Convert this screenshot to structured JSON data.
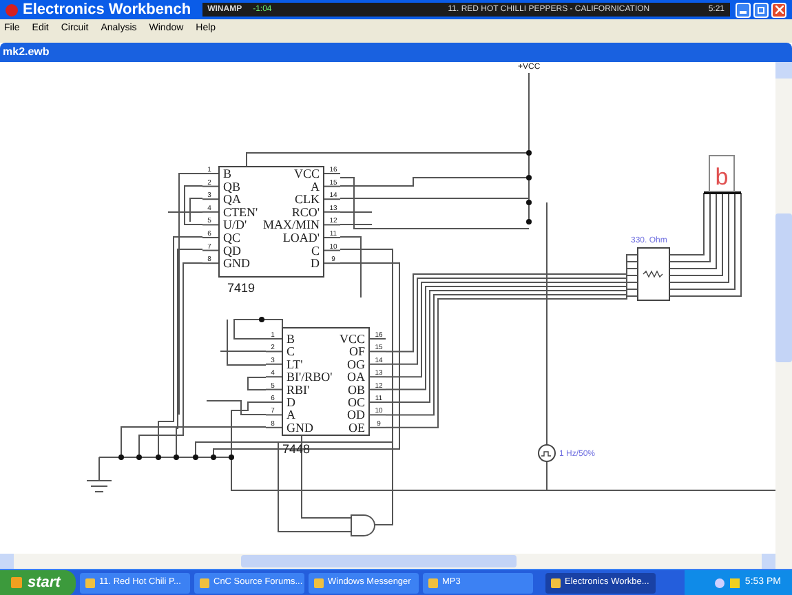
{
  "window": {
    "title": "Electronics Workbench"
  },
  "winamp": {
    "label": "WINAMP",
    "time": "-1:04",
    "track": "11. RED HOT CHILLI PEPPERS - CALIFORNICATION",
    "length": "5:21"
  },
  "menu": [
    "File",
    "Edit",
    "Circuit",
    "Analysis",
    "Window",
    "Help"
  ],
  "document": {
    "title": "mk2.ewb"
  },
  "circuit": {
    "supply": "+VCC",
    "chips": [
      {
        "part": "7419",
        "left_pins": [
          {
            "number": "1",
            "label": "B"
          },
          {
            "number": "2",
            "label": "QB"
          },
          {
            "number": "3",
            "label": "QA"
          },
          {
            "number": "4",
            "label": "CTEN'"
          },
          {
            "number": "5",
            "label": "U/D'"
          },
          {
            "number": "6",
            "label": "QC"
          },
          {
            "number": "7",
            "label": "QD"
          },
          {
            "number": "8",
            "label": "GND"
          }
        ],
        "right_pins": [
          {
            "number": "16",
            "label": "VCC"
          },
          {
            "number": "15",
            "label": "A"
          },
          {
            "number": "14",
            "label": "CLK"
          },
          {
            "number": "13",
            "label": "RCO'"
          },
          {
            "number": "12",
            "label": "MAX/MIN"
          },
          {
            "number": "11",
            "label": "LOAD'"
          },
          {
            "number": "10",
            "label": "C"
          },
          {
            "number": "9",
            "label": "D"
          }
        ]
      },
      {
        "part": "7448",
        "left_pins": [
          {
            "number": "1",
            "label": "B"
          },
          {
            "number": "2",
            "label": "C"
          },
          {
            "number": "3",
            "label": "LT'"
          },
          {
            "number": "4",
            "label": "BI'/RBO'"
          },
          {
            "number": "5",
            "label": "RBI'"
          },
          {
            "number": "6",
            "label": "D"
          },
          {
            "number": "7",
            "label": "A"
          },
          {
            "number": "8",
            "label": "GND"
          }
        ],
        "right_pins": [
          {
            "number": "16",
            "label": "VCC"
          },
          {
            "number": "15",
            "label": "OF"
          },
          {
            "number": "14",
            "label": "OG"
          },
          {
            "number": "13",
            "label": "OA"
          },
          {
            "number": "12",
            "label": "OB"
          },
          {
            "number": "11",
            "label": "OC"
          },
          {
            "number": "10",
            "label": "OD"
          },
          {
            "number": "9",
            "label": "OE"
          }
        ]
      }
    ],
    "resistor": "330. Ohm",
    "clock": "1 Hz/50%",
    "display": "b"
  },
  "taskbar": {
    "start": "start",
    "items": [
      {
        "label": "11. Red Hot Chili P...",
        "selected": false
      },
      {
        "label": "CnC Source Forums...",
        "selected": false
      },
      {
        "label": "Windows Messenger",
        "selected": false
      },
      {
        "label": "MP3",
        "selected": false
      },
      {
        "label": "Electronics Workbe...",
        "selected": true
      }
    ],
    "clock": "5:53 PM"
  }
}
